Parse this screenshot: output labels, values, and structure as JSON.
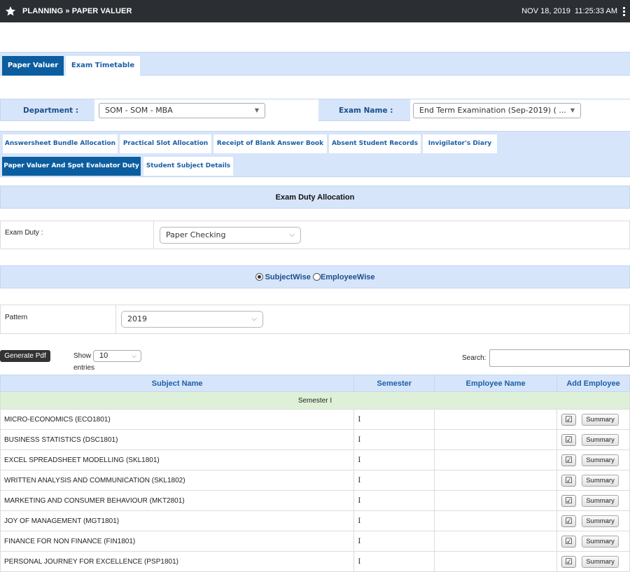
{
  "header": {
    "title": "PLANNING » PAPER VALUER",
    "date": "NOV 18, 2019",
    "time": "11:25:33 AM"
  },
  "main_tabs": [
    {
      "label": "Paper Valuer",
      "active": true
    },
    {
      "label": "Exam Timetable",
      "active": false
    }
  ],
  "filters": {
    "department_label": "Department :",
    "department_value": "SOM - SOM - MBA",
    "exam_name_label": "Exam Name :",
    "exam_name_value": "End Term Examination (Sep-2019) ( ..."
  },
  "sub_tabs": [
    {
      "label": "Answersheet Bundle Allocation",
      "active": false
    },
    {
      "label": "Practical Slot Allocation",
      "active": false
    },
    {
      "label": "Receipt of Blank Answer Book",
      "active": false
    },
    {
      "label": "Absent Student Records",
      "active": false
    },
    {
      "label": "Invigilator's Diary",
      "active": false
    },
    {
      "label": "Paper Valuer And Spot Evaluator Duty",
      "active": true
    },
    {
      "label": "Student Subject Details",
      "active": false
    }
  ],
  "section": {
    "title": "Exam Duty Allocation",
    "exam_duty_label": "Exam Duty :",
    "exam_duty_value": "Paper Checking",
    "radio_subjectwise": "SubjectWise",
    "radio_employeewise": "EmployeeWise",
    "selected_mode": "SubjectWise",
    "pattern_label": "Pattern",
    "pattern_value": "2019"
  },
  "table_controls": {
    "generate_pdf": "Generate Pdf",
    "show_label": "Show",
    "entries_value": "10",
    "entries_label": "entries",
    "search_label": "Search:"
  },
  "table": {
    "columns": [
      "Subject Name",
      "Semester",
      "Employee Name",
      "Add Employee"
    ],
    "group_label": "Semester I",
    "summary_label": "Summary",
    "rows": [
      {
        "subject": "MICRO-ECONOMICS (ECO1801)",
        "semester": "I",
        "employee": ""
      },
      {
        "subject": "BUSINESS STATISTICS (DSC1801)",
        "semester": "I",
        "employee": ""
      },
      {
        "subject": "EXCEL SPREADSHEET MODELLING (SKL1801)",
        "semester": "I",
        "employee": ""
      },
      {
        "subject": "WRITTEN ANALYSIS AND COMMUNICATION (SKL1802)",
        "semester": "I",
        "employee": ""
      },
      {
        "subject": "MARKETING AND CONSUMER BEHAVIOUR (MKT2801)",
        "semester": "I",
        "employee": ""
      },
      {
        "subject": "JOY OF MANAGEMENT (MGT1801)",
        "semester": "I",
        "employee": ""
      },
      {
        "subject": "FINANCE FOR NON FINANCE (FIN1801)",
        "semester": "I",
        "employee": ""
      },
      {
        "subject": "PERSONAL JOURNEY FOR EXCELLENCE (PSP1801)",
        "semester": "I",
        "employee": ""
      }
    ]
  },
  "colors": {
    "topbar": "#2b2f33",
    "tab_active": "#0b5d9f",
    "band": "#d6e5fa",
    "group_row": "#dff0d8"
  }
}
